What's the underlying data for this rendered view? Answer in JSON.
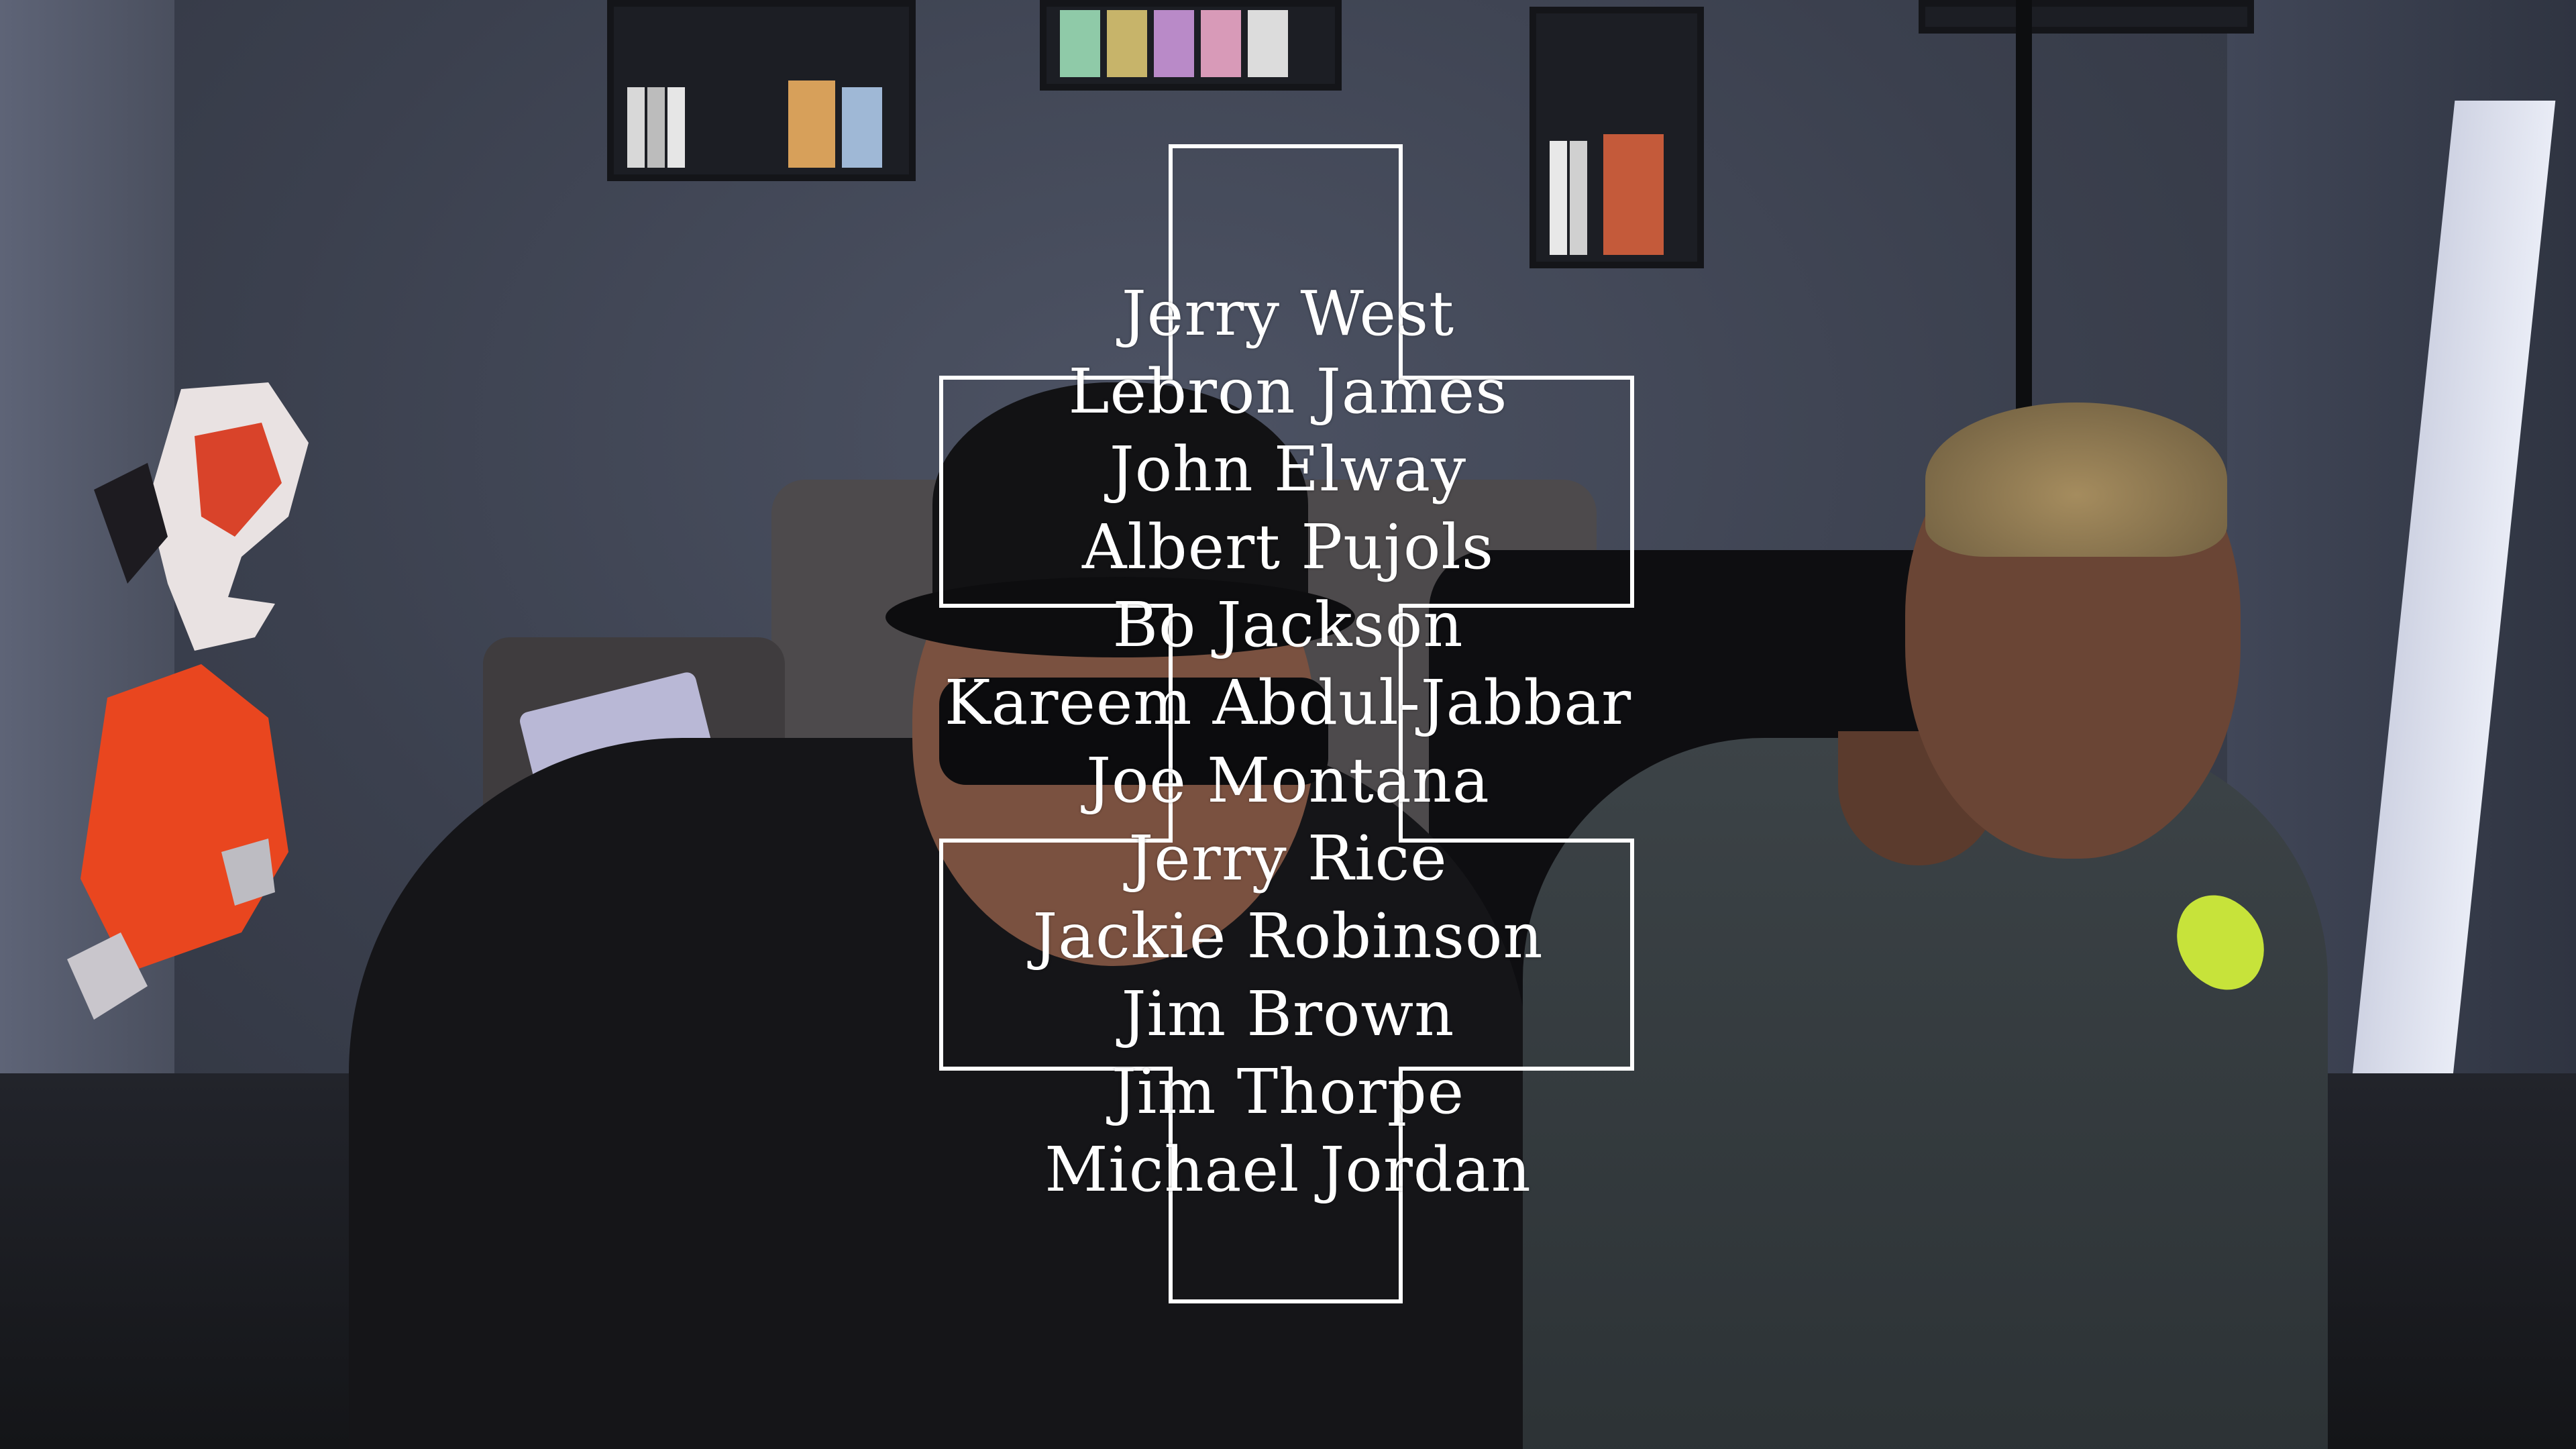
{
  "background": {
    "description_icon": "webcam-video-frame",
    "colors": {
      "wall": "#3b404e",
      "overlay_stroke": "#ffffff",
      "text": "#ffffff"
    }
  },
  "overlay": {
    "icon": "cross-outline-icon",
    "names": [
      "Jerry West",
      "Lebron James",
      "John Elway",
      "Albert Pujols",
      "Bo Jackson",
      "Kareem Abdul-Jabbar",
      "Joe Montana",
      "Jerry Rice",
      "Jackie Robinson",
      "Jim Brown",
      "Jim Thorpe",
      "Michael Jordan"
    ]
  }
}
